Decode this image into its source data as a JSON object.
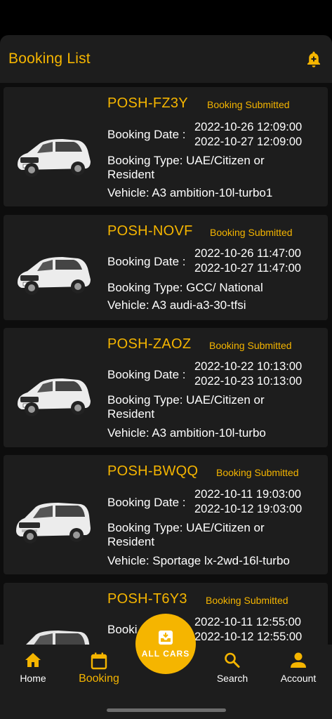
{
  "header": {
    "title": "Booking List",
    "icon": "bell-icon"
  },
  "bookings": [
    {
      "code": "POSH-FZ3Y",
      "status": "Booking Submitted",
      "date_label": "Booking Date :",
      "start": "2022-10-26 12:09:00",
      "end": "2022-10-27 12:09:00",
      "type": "Booking Type: UAE/Citizen or Resident",
      "vehicle": "Vehicle: A3 ambition-10l-turbo1",
      "car": "white-hatchback"
    },
    {
      "code": "POSH-NOVF",
      "status": "Booking Submitted",
      "date_label": "Booking Date :",
      "start": "2022-10-26 11:47:00",
      "end": "2022-10-27 11:47:00",
      "type": "Booking Type: GCC/ National",
      "vehicle": "Vehicle: A3 audi-a3-30-tfsi",
      "car": "white-hatchback"
    },
    {
      "code": "POSH-ZAOZ",
      "status": "Booking Submitted",
      "date_label": "Booking Date :",
      "start": "2022-10-22 10:13:00",
      "end": "2022-10-23 10:13:00",
      "type": "Booking Type: UAE/Citizen or Resident",
      "vehicle": "Vehicle: A3 ambition-10l-turbo",
      "car": "white-hatchback"
    },
    {
      "code": "POSH-BWQQ",
      "status": "Booking Submitted",
      "date_label": "Booking Date :",
      "start": "2022-10-11 19:03:00",
      "end": "2022-10-12 19:03:00",
      "type": "Booking Type: UAE/Citizen or Resident",
      "vehicle": "Vehicle: Sportage lx-2wd-16l-turbo",
      "car": "white-suv"
    },
    {
      "code": "POSH-T6Y3",
      "status": "Booking Submitted",
      "date_label": "Booki",
      "start": "2022-10-11 12:55:00",
      "end": "2022-10-12 12:55:00",
      "type": "",
      "vehicle": "",
      "car": "white-suv"
    }
  ],
  "nav": {
    "home": "Home",
    "booking": "Booking",
    "all_cars": "ALL CARS",
    "search": "Search",
    "account": "Account"
  },
  "colors": {
    "accent": "#f5b500",
    "card": "#1d1d1d",
    "background": "#0d0d0d"
  }
}
